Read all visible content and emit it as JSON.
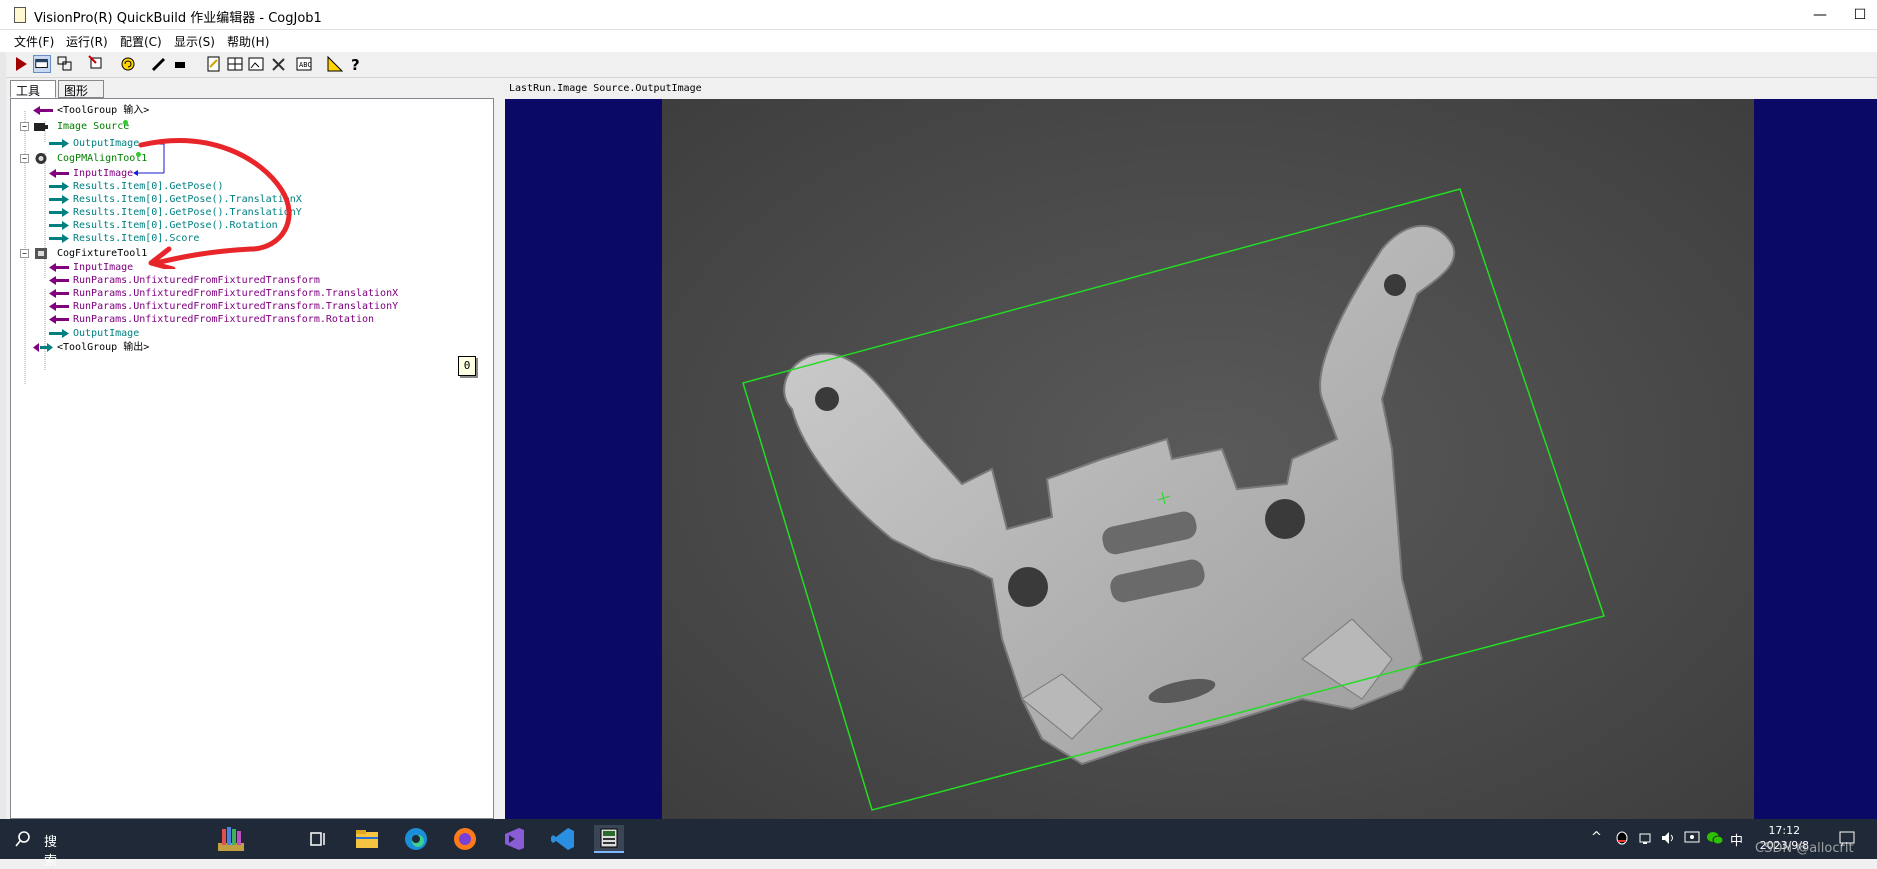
{
  "window": {
    "title": "VisionPro(R) QuickBuild 作业编辑器 - CogJob1",
    "minimize": "—",
    "maximize": "☐"
  },
  "menu": [
    "文件(F)",
    "运行(R)",
    "配置(C)",
    "显示(S)",
    "帮助(H)"
  ],
  "tabs": [
    "工具",
    "图形"
  ],
  "tree": {
    "toolgroup_in": "<ToolGroup 输入>",
    "image_source": "Image Source",
    "image_source_output": "OutputImage",
    "pmalign": "CogPMAlignTool1",
    "pmalign_input": "InputImage",
    "pmalign_results": [
      "Results.Item[0].GetPose()",
      "Results.Item[0].GetPose().TranslationX",
      "Results.Item[0].GetPose().TranslationY",
      "Results.Item[0].GetPose().Rotation",
      "Results.Item[0].Score"
    ],
    "fixture": "CogFixtureTool1",
    "fixture_input": "InputImage",
    "fixture_params": [
      "RunParams.UnfixturedFromFixturedTransform",
      "RunParams.UnfixturedFromFixturedTransform.TranslationX",
      "RunParams.UnfixturedFromFixturedTransform.TranslationY",
      "RunParams.UnfixturedFromFixturedTransform.Rotation"
    ],
    "fixture_output": "OutputImage",
    "toolgroup_out": "<ToolGroup 输出>"
  },
  "badge": "0",
  "viewer": {
    "caption": "LastRun.Image Source.OutputImage"
  },
  "taskbar": {
    "search": "搜索",
    "ime": "中",
    "time": "17:12",
    "date": "2023/9/8",
    "watermark": "CSDN @allocrlt"
  },
  "colors": {
    "teal": "#008080",
    "purple": "#800080",
    "green": "#008000",
    "viewer_bg": "#0a0a66",
    "annotation_red": "#e8262a",
    "result_box": "#22dd22"
  }
}
